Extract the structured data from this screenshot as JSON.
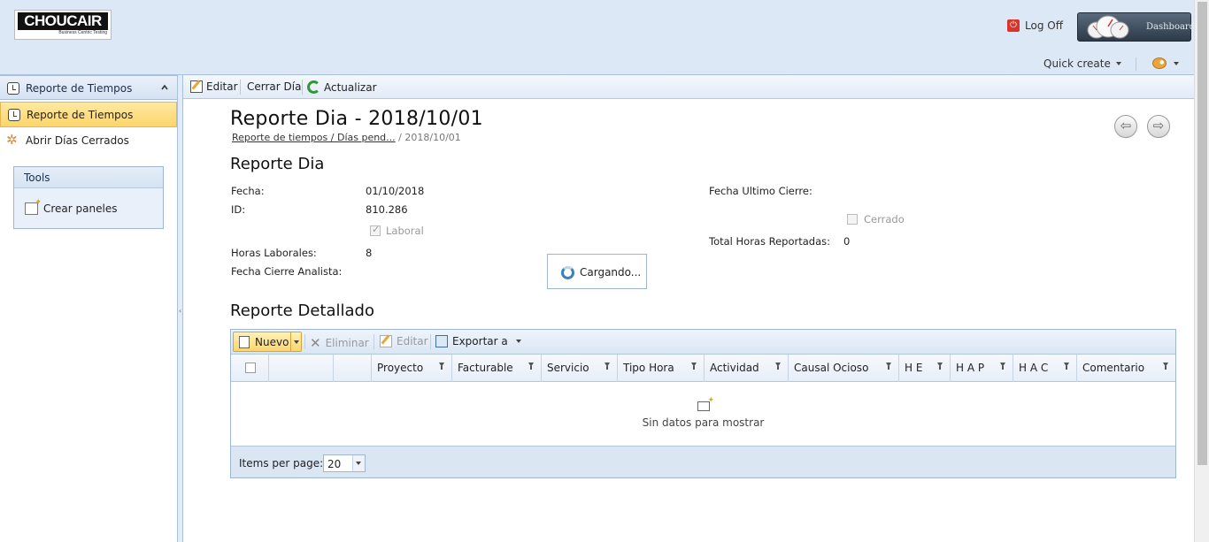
{
  "header": {
    "logo_text": "CHOUCAIR",
    "logo_tagline": "Business Centric Testing",
    "logoff_label": "Log Off",
    "dashboard_label": "Dashboard",
    "quick_create_label": "Quick create"
  },
  "sidebar": {
    "section_title": "Reporte de Tiempos",
    "items": [
      {
        "label": "Reporte de Tiempos",
        "icon": "clock-icon",
        "selected": true
      },
      {
        "label": "Abrir Días Cerrados",
        "icon": "gear-icon",
        "selected": false
      }
    ],
    "tools": {
      "title": "Tools",
      "items": [
        {
          "label": "Crear paneles",
          "icon": "new-panel-icon"
        }
      ]
    }
  },
  "toolbar": {
    "edit_label": "Editar",
    "close_day_label": "Cerrar Día",
    "refresh_label": "Actualizar"
  },
  "page": {
    "title": "Reporte Dia - 2018/10/01",
    "breadcrumb_link": "Reporte de tiempos / Días pend...",
    "breadcrumb_current": "/ 2018/10/01"
  },
  "form": {
    "section_title": "Reporte Dia",
    "fecha_label": "Fecha:",
    "fecha_value": "01/10/2018",
    "id_label": "ID:",
    "id_value": "810.286",
    "laboral_label": "Laboral",
    "laboral_checked": true,
    "horas_label": "Horas Laborales:",
    "horas_value": "8",
    "cierre_analista_label": "Fecha Cierre Analista:",
    "cierre_analista_value": "",
    "ultimo_cierre_label": "Fecha Ultimo Cierre:",
    "ultimo_cierre_value": "",
    "cerrado_label": "Cerrado",
    "cerrado_checked": false,
    "total_horas_label": "Total Horas Reportadas:",
    "total_horas_value": "0",
    "loading_text": "Cargando..."
  },
  "detail": {
    "section_title": "Reporte Detallado",
    "toolbar": {
      "new_label": "Nuevo",
      "delete_label": "Eliminar",
      "edit_label": "Editar",
      "export_label": "Exportar a"
    },
    "columns": [
      "Proyecto",
      "Facturable",
      "Servicio",
      "Tipo Hora",
      "Actividad",
      "Causal Ocioso",
      "H E",
      "H A P",
      "H A C",
      "Comentario"
    ],
    "empty_text": "Sin datos para mostrar",
    "items_per_page_label": "Items per page:",
    "items_per_page_value": "20"
  },
  "colors": {
    "header_bg": "#dde8f6",
    "selected_bg": "#fcd56b",
    "border": "#9fb6d2"
  }
}
